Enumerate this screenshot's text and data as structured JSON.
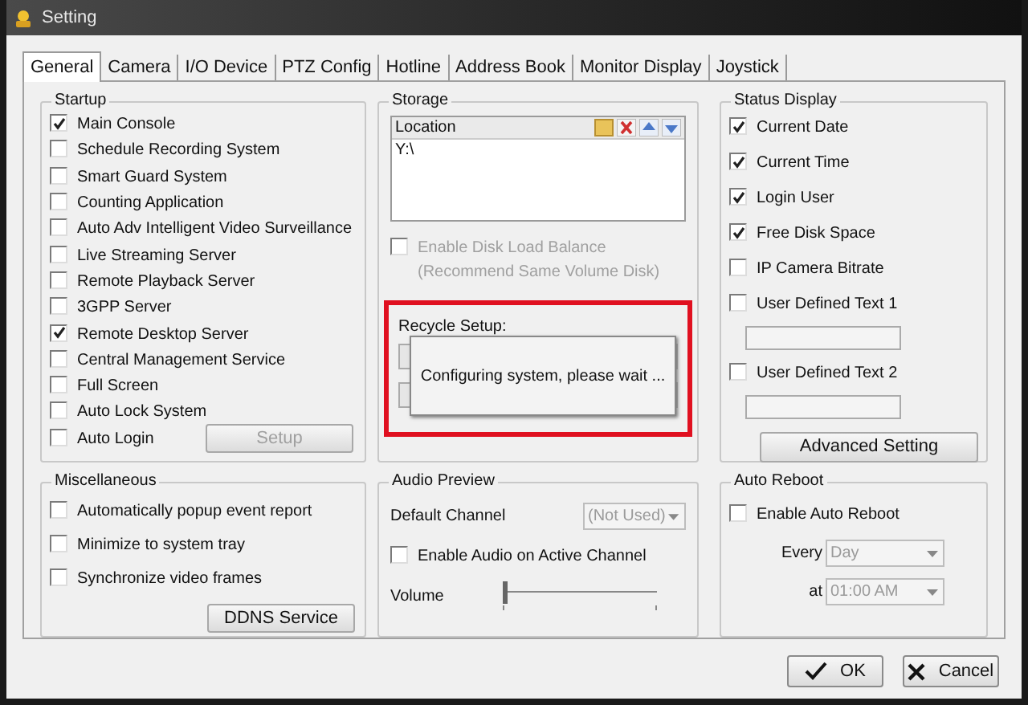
{
  "window": {
    "title": "Setting"
  },
  "tabs": [
    {
      "label": "General",
      "selected": true
    },
    {
      "label": "Camera",
      "selected": false
    },
    {
      "label": "I/O Device",
      "selected": false
    },
    {
      "label": "PTZ Config",
      "selected": false
    },
    {
      "label": "Hotline",
      "selected": false
    },
    {
      "label": "Address Book",
      "selected": false
    },
    {
      "label": "Monitor Display",
      "selected": false
    },
    {
      "label": "Joystick",
      "selected": false
    }
  ],
  "startup": {
    "title": "Startup",
    "items": [
      {
        "label": "Main Console",
        "checked": true
      },
      {
        "label": "Schedule Recording System",
        "checked": false
      },
      {
        "label": "Smart Guard System",
        "checked": false
      },
      {
        "label": "Counting Application",
        "checked": false
      },
      {
        "label": "Auto Adv Intelligent Video Surveillance",
        "checked": false
      },
      {
        "label": "Live Streaming Server",
        "checked": false
      },
      {
        "label": "Remote Playback Server",
        "checked": false
      },
      {
        "label": "3GPP Server",
        "checked": false
      },
      {
        "label": "Remote Desktop Server",
        "checked": true
      },
      {
        "label": "Central Management Service",
        "checked": false
      },
      {
        "label": "Full Screen",
        "checked": false
      },
      {
        "label": "Auto Lock System",
        "checked": false
      },
      {
        "label": "Auto Login",
        "checked": false
      }
    ],
    "setup_button": {
      "label": "Setup",
      "disabled": true
    }
  },
  "storage": {
    "title": "Storage",
    "list_header": "Location",
    "locations": [
      "Y:\\"
    ],
    "load_balance": {
      "label": "Enable Disk Load Balance (Recommend Same Volume Disk)",
      "checked": false,
      "disabled": true
    },
    "recycle_label": "Recycle Setup:",
    "dialog_message": "Configuring system, please wait ..."
  },
  "status_display": {
    "title": "Status Display",
    "items": [
      {
        "label": "Current Date",
        "checked": true,
        "kind": "check"
      },
      {
        "label": "Current Time",
        "checked": true,
        "kind": "check"
      },
      {
        "label": "Login User",
        "checked": true,
        "kind": "check"
      },
      {
        "label": "Free Disk Space",
        "checked": true,
        "kind": "check"
      },
      {
        "label": "IP Camera Bitrate",
        "checked": false,
        "kind": "check"
      },
      {
        "label": "User Defined Text 1",
        "checked": false,
        "kind": "text"
      },
      {
        "label": "User Defined Text 2",
        "checked": false,
        "kind": "text"
      }
    ],
    "button": "Advanced Setting"
  },
  "miscellaneous": {
    "title": "Miscellaneous",
    "items": [
      {
        "label": "Automatically popup event report",
        "checked": false
      },
      {
        "label": "Minimize to system tray",
        "checked": false
      },
      {
        "label": "Synchronize video frames",
        "checked": false
      }
    ],
    "button": "DDNS Service"
  },
  "audio_preview": {
    "title": "Audio Preview",
    "default_channel_label": "Default Channel",
    "default_channel_value": "(Not Used)",
    "enable_audio": {
      "label": "Enable Audio on Active Channel",
      "checked": false
    },
    "volume_label": "Volume",
    "volume": {
      "level": 0
    }
  },
  "auto_reboot": {
    "title": "Auto Reboot",
    "enable": {
      "label": "Enable Auto Reboot",
      "checked": false
    },
    "every_label": "Every",
    "every_value": "Day",
    "at_label": "at",
    "at_value": "01:00 AM"
  },
  "buttons": [
    {
      "label": "OK",
      "kind": "ok"
    },
    {
      "label": "Cancel",
      "kind": "cancel"
    }
  ]
}
